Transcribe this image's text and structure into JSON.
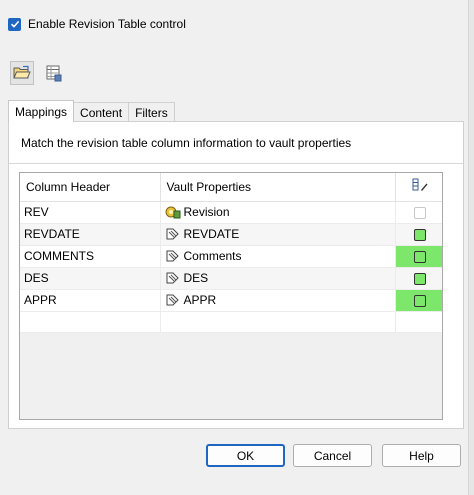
{
  "options": {
    "enable_label": "Enable Revision Table control",
    "enable_checked": true
  },
  "toolbar": {
    "icons": [
      "folder-open-icon",
      "table-settings-icon"
    ]
  },
  "tabs": [
    {
      "label": "Mappings",
      "active": true
    },
    {
      "label": "Content",
      "active": false
    },
    {
      "label": "Filters",
      "active": false
    }
  ],
  "mappings": {
    "description": "Match the revision table column information to vault properties",
    "columns": {
      "header": "Column Header",
      "vault": "Vault Properties",
      "edit_icon": "editable-column-icon"
    },
    "rows": [
      {
        "header": "REV",
        "vault": "Revision",
        "icon": "revision-property-icon",
        "editable_enabled": false
      },
      {
        "header": "REVDATE",
        "vault": "REVDATE",
        "icon": "user-property-icon",
        "editable_enabled": true
      },
      {
        "header": "COMMENTS",
        "vault": "Comments",
        "icon": "user-property-icon",
        "editable_enabled": true
      },
      {
        "header": "DES",
        "vault": "DES",
        "icon": "user-property-icon",
        "editable_enabled": true
      },
      {
        "header": "APPR",
        "vault": "APPR",
        "icon": "user-property-icon",
        "editable_enabled": true
      }
    ]
  },
  "buttons": {
    "ok": "OK",
    "cancel": "Cancel",
    "help": "Help"
  },
  "colors": {
    "accent": "#1f66c1",
    "highlight": "#8cf07c"
  }
}
